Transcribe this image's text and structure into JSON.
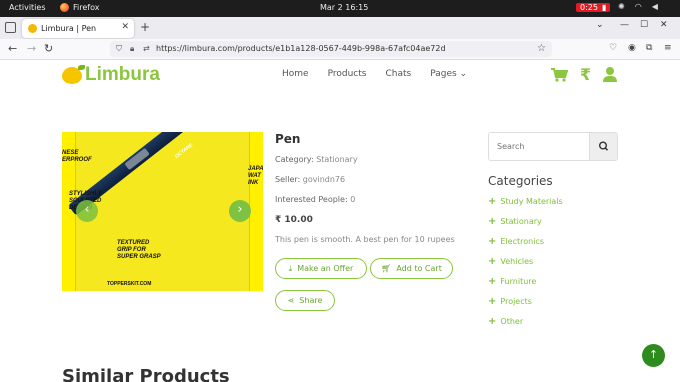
{
  "system": {
    "activities": "Activities",
    "app_name": "Firefox",
    "clock": "Mar 2  16:15",
    "battery": "0:25"
  },
  "browser": {
    "tab_title": "Limbura | Pen",
    "new_tab": "+",
    "url": "https://limbura.com/products/e1b1a128-0567-449b-998a-67afc04ae72d"
  },
  "site": {
    "brand": "Limbura",
    "menu": [
      "Home",
      "Products",
      "Chats",
      "Pages"
    ],
    "rupee_symbol": "₹"
  },
  "product": {
    "title": "Pen",
    "category_label": "Category:",
    "category": "Stationary",
    "seller_label": "Seller:",
    "seller": "govindn76",
    "interested_label": "Interested People:",
    "interested": "0",
    "price": "₹ 10.00",
    "description": "This pen is smooth. A best pen for 10 rupees",
    "offer_button": "Make an Offer",
    "cart_button": "Add to Cart",
    "share_button": "Share",
    "image_text": {
      "left_edge": "NESE\nERPROOF",
      "right_edge": "JAPA\nWAT\nINK",
      "callout1": "STYLISHLY\nSCULPTED\nDESIGN",
      "callout2": "TEXTURED\nGRIP FOR\nSUPER GRASP",
      "brand_mark": "TOPPERSKIT.COM",
      "pen_brand": "OCTANE"
    }
  },
  "sidebar": {
    "search_placeholder": "Search",
    "categories_title": "Categories",
    "categories": [
      "Study Materials",
      "Stationary",
      "Electronics",
      "Vehicles",
      "Furniture",
      "Projects",
      "Other"
    ]
  },
  "section": {
    "similar_title": "Similar Products"
  },
  "colors": {
    "brand_green": "#8cc63f",
    "accent_dark_green": "#2e8b1e",
    "battery_red": "#e01b24"
  }
}
